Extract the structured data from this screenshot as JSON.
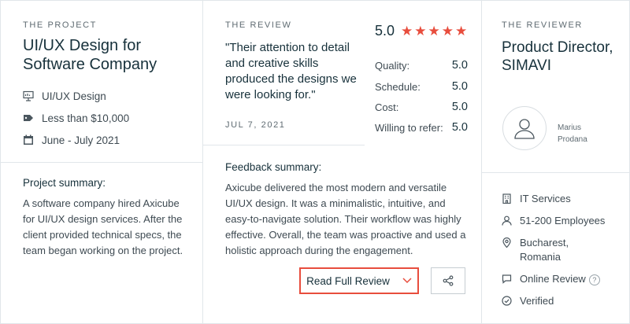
{
  "project": {
    "eyebrow": "THE PROJECT",
    "title": "UI/UX Design for Software Company",
    "service": "UI/UX Design",
    "budget": "Less than $10,000",
    "timeline": "June - July 2021",
    "summary_label": "Project summary:",
    "summary": "A software company hired Axicube for UI/UX design services. After the client provided technical specs, the team began working on the project."
  },
  "review": {
    "eyebrow": "THE REVIEW",
    "quote": "\"Their attention to detail and creative skills produced the designs we were looking for.\"",
    "date": "JUL 7, 2021",
    "overall": "5.0",
    "star_count": 5,
    "ratings": [
      {
        "label": "Quality:",
        "value": "5.0"
      },
      {
        "label": "Schedule:",
        "value": "5.0"
      },
      {
        "label": "Cost:",
        "value": "5.0"
      },
      {
        "label": "Willing to refer:",
        "value": "5.0"
      }
    ],
    "feedback_label": "Feedback summary:",
    "feedback": "Axicube delivered the most modern and versatile UI/UX design. It was a minimalistic, intuitive, and easy-to-navigate solution. Their workflow was highly effective. Overall, the team was proactive and used a holistic approach during the engagement.",
    "read_button": "Read Full Review",
    "share_icon": "share-icon"
  },
  "reviewer": {
    "eyebrow": "THE REVIEWER",
    "title": "Product Director, SIMAVI",
    "name": "Marius Prodana",
    "industry": "IT Services",
    "employees": "51-200 Employees",
    "location": "Bucharest, Romania",
    "review_type": "Online Review",
    "help_glyph": "?",
    "verified": "Verified"
  },
  "colors": {
    "accent": "#e84d3d",
    "text": "#17313b",
    "muted": "#5f6b72",
    "border": "#e1e6ea"
  }
}
